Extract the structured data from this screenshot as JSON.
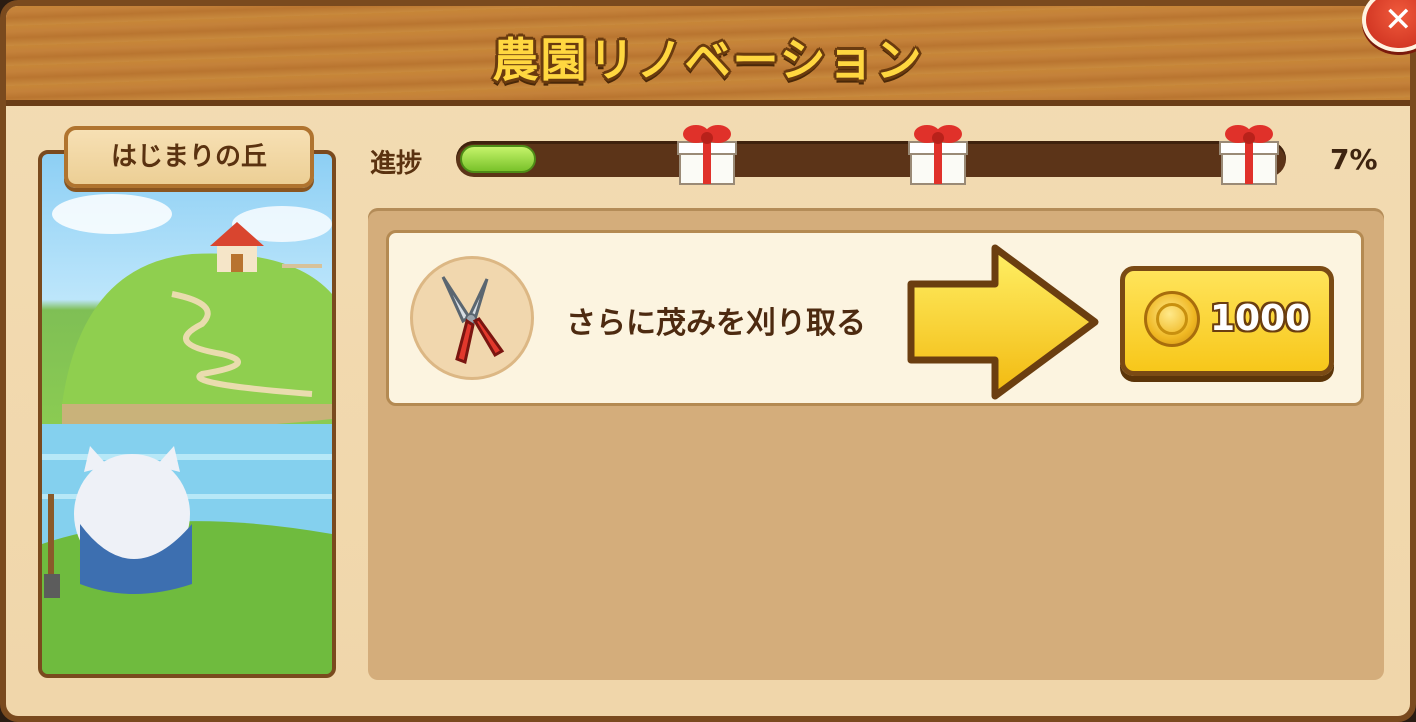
{
  "window": {
    "title": "農園リノベーション"
  },
  "stage": {
    "name": "はじまりの丘"
  },
  "progress": {
    "label": "進捗",
    "value": 0.07,
    "percent_text": "7%",
    "rewards": [
      "gift-icon",
      "gift-icon",
      "gift-icon"
    ]
  },
  "tasks": [
    {
      "icon": "pruning-shears-icon",
      "text": "さらに茂みを刈り取る",
      "cost": "1000",
      "currency_icon": "gold-coin-icon"
    }
  ],
  "colors": {
    "title": "#ffd740",
    "accent_button": "#f7c71a",
    "progress_fill": "#79c22a",
    "close_button": "#c82b1b"
  }
}
